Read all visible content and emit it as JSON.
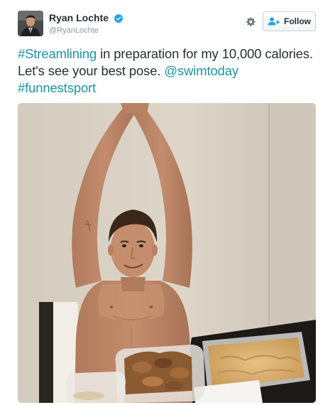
{
  "author": {
    "name": "Ryan Lochte",
    "handle": "@RyanLochte",
    "verified": true
  },
  "actions": {
    "follow_label": "Follow"
  },
  "tweet": {
    "segments": [
      {
        "text": "#Streamlining",
        "link": true
      },
      {
        "text": " in preparation for my 10,000 calories. Let's see your best pose. ",
        "link": false
      },
      {
        "text": "@swimtoday",
        "link": true
      },
      {
        "text": " ",
        "link": false
      },
      {
        "text": "#funnestsport",
        "link": true
      }
    ]
  },
  "icons": {
    "verified": "verified-badge-icon",
    "gear": "gear-icon",
    "follow": "add-person-icon"
  },
  "colors": {
    "link": "#1b95a6",
    "text": "#292f33",
    "handle": "#8899a6",
    "verified": "#1da1f2",
    "follow_icon": "#1da1f2"
  }
}
